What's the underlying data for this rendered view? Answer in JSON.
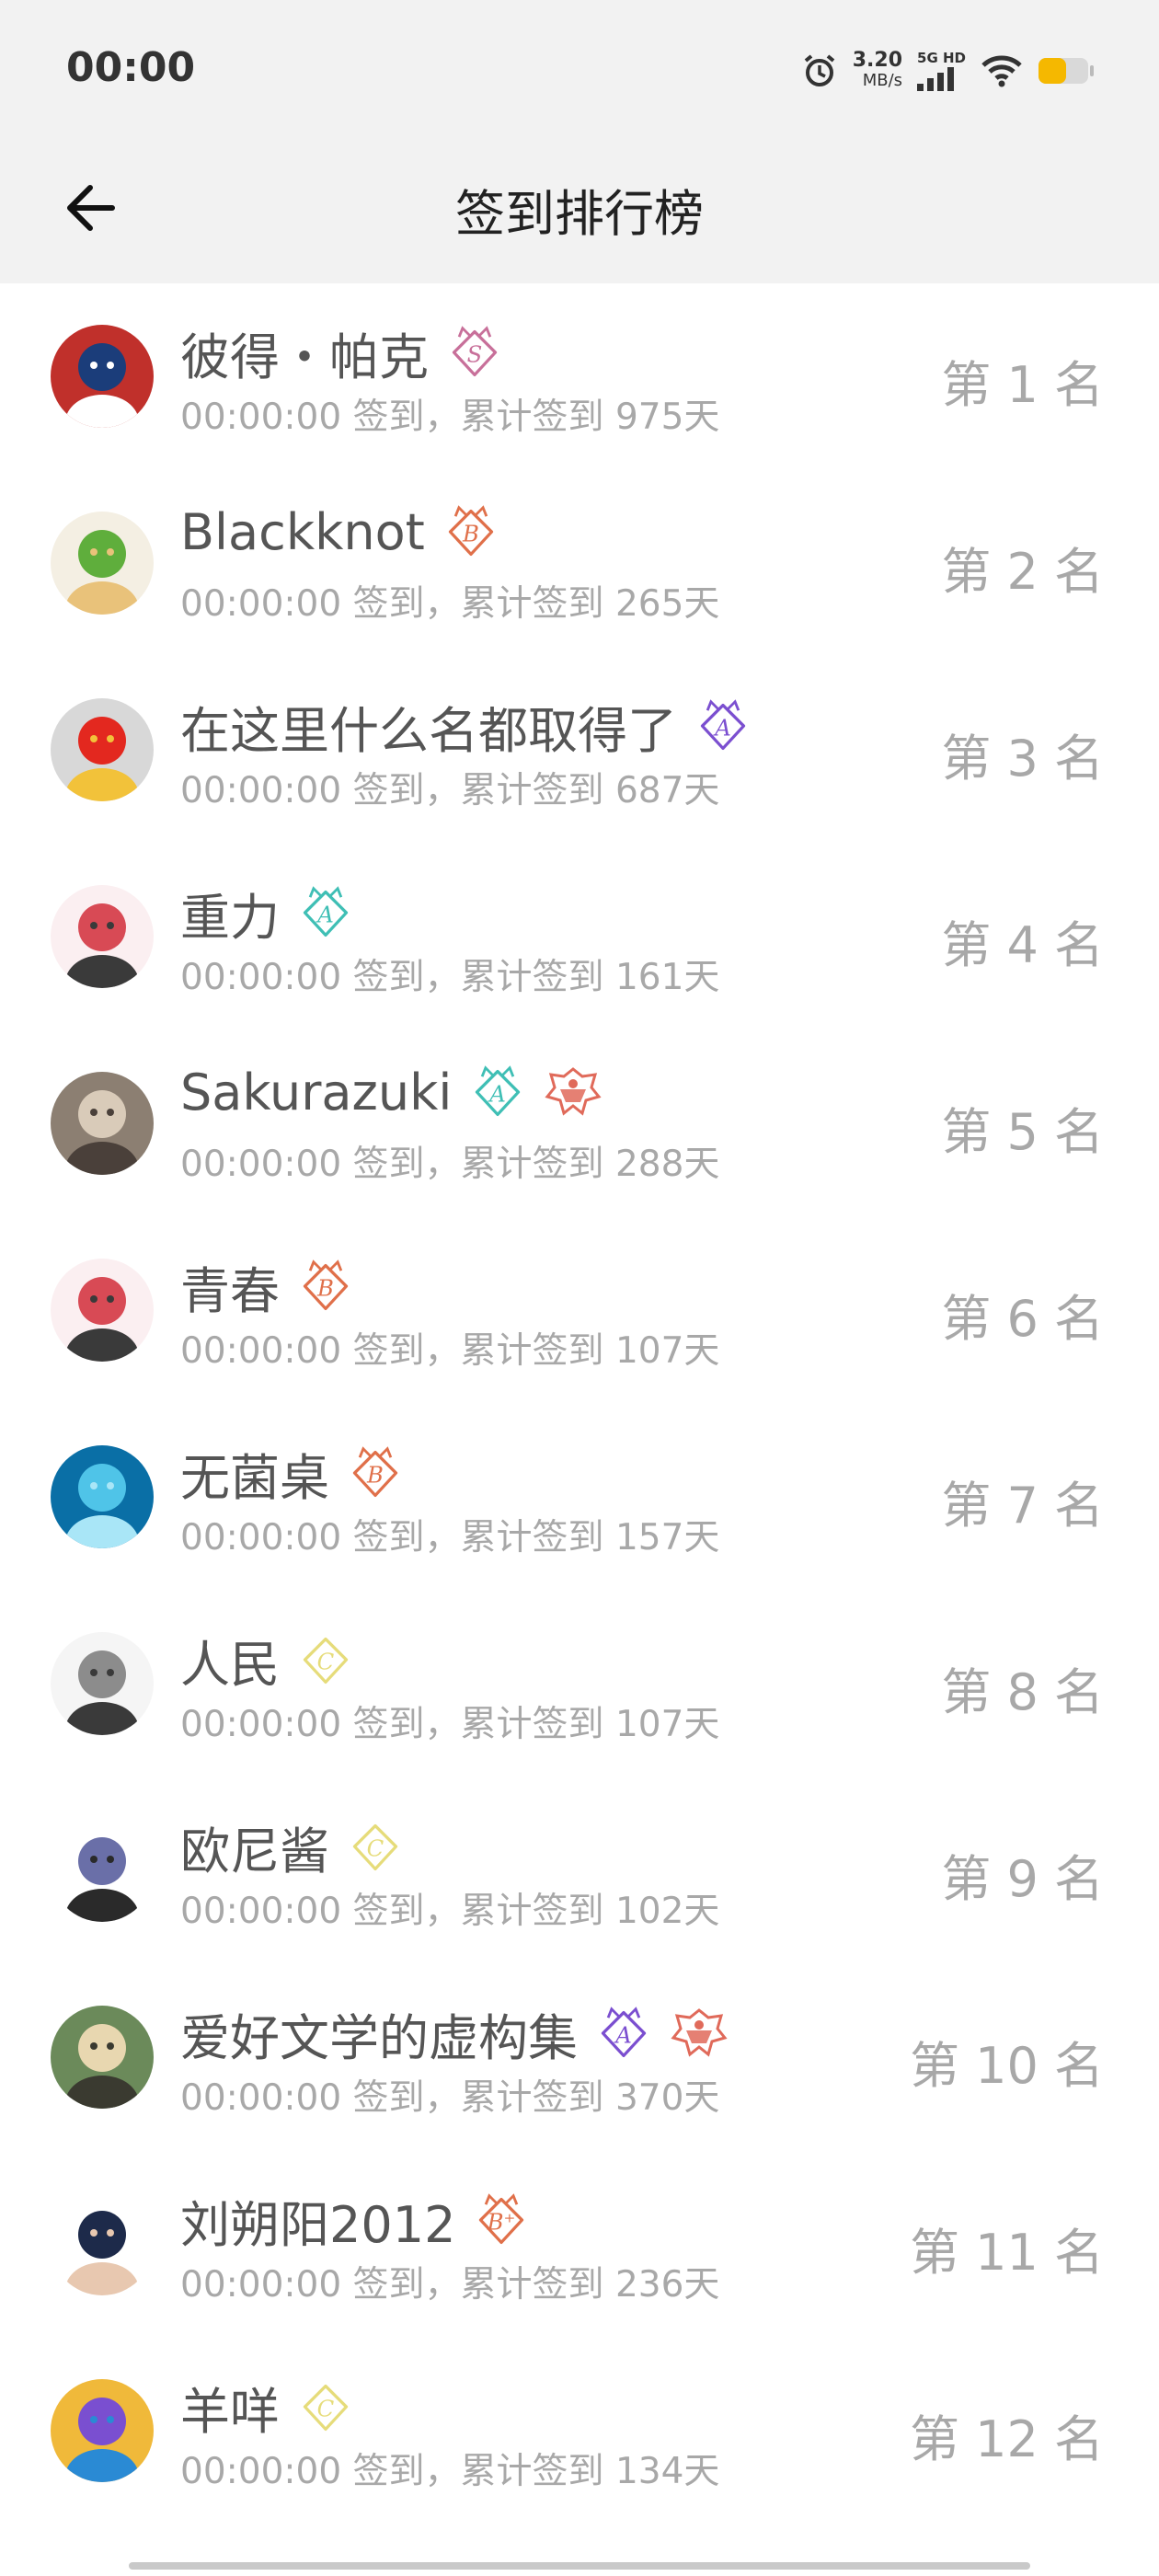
{
  "status_bar": {
    "time": "00:00",
    "net_speed": "3.20",
    "net_unit": "MB/s",
    "signal_label": "5G HD",
    "battery_color": "#f5b800"
  },
  "header": {
    "title": "签到排行榜",
    "back_icon": "arrow-left-icon"
  },
  "rows": [
    {
      "name": "彼得・帕克",
      "info": "00:00:00 签到，累计签到 975天",
      "rank": "第 1 名",
      "badges": [
        "S"
      ]
    },
    {
      "name": "Blackknot",
      "info": "00:00:00 签到，累计签到 265天",
      "rank": "第 2 名",
      "badges": [
        "B"
      ]
    },
    {
      "name": "在这里什么名都取得了",
      "info": "00:00:00 签到，累计签到 687天",
      "rank": "第 3 名",
      "badges": [
        "A-purple"
      ]
    },
    {
      "name": "重力",
      "info": "00:00:00 签到，累计签到 161天",
      "rank": "第 4 名",
      "badges": [
        "A-teal"
      ]
    },
    {
      "name": "Sakurazuki",
      "info": "00:00:00 签到，累计签到 288天",
      "rank": "第 5 名",
      "badges": [
        "A-teal",
        "crest"
      ]
    },
    {
      "name": "青春",
      "info": "00:00:00 签到，累计签到 107天",
      "rank": "第 6 名",
      "badges": [
        "B"
      ]
    },
    {
      "name": "无菌桌",
      "info": "00:00:00 签到，累计签到 157天",
      "rank": "第 7 名",
      "badges": [
        "B"
      ]
    },
    {
      "name": "人民",
      "info": "00:00:00 签到，累计签到 107天",
      "rank": "第 8 名",
      "badges": [
        "C"
      ]
    },
    {
      "name": "欧尼酱",
      "info": "00:00:00 签到，累计签到 102天",
      "rank": "第 9 名",
      "badges": [
        "C"
      ]
    },
    {
      "name": "爱好文学的虚构集",
      "info": "00:00:00 签到，累计签到 370天",
      "rank": "第 10 名",
      "badges": [
        "A-purple",
        "crest"
      ]
    },
    {
      "name": "刘朔阳2012",
      "info": "00:00:00 签到，累计签到 236天",
      "rank": "第 11 名",
      "badges": [
        "B+"
      ]
    },
    {
      "name": "羊咩",
      "info": "00:00:00 签到，累计签到 134天",
      "rank": "第 12 名",
      "badges": [
        "C"
      ]
    }
  ],
  "colors": {
    "badge_S": "#c8709a",
    "badge_B": "#e0704a",
    "badge_A_purple": "#7b4fd0",
    "badge_A_teal": "#3fbfb5",
    "badge_C": "#e6dc7a",
    "crest": "#e06a5a"
  }
}
